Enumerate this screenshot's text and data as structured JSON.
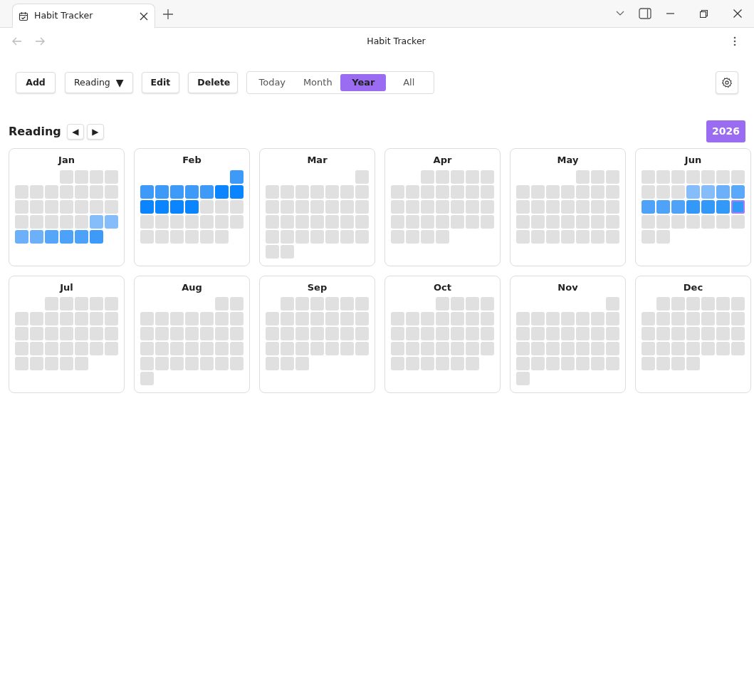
{
  "browser_tab": {
    "title": "Habit Tracker"
  },
  "page_title": "Habit Tracker",
  "toolbar": {
    "add": "Add",
    "habit_select": {
      "label": "Reading",
      "caret": "▼"
    },
    "edit": "Edit",
    "delete": "Delete"
  },
  "range_tabs": [
    {
      "label": "Today",
      "selected": false
    },
    {
      "label": "Month",
      "selected": false
    },
    {
      "label": "Year",
      "selected": true
    },
    {
      "label": "All",
      "selected": false
    }
  ],
  "habit_header": {
    "title": "Reading",
    "prev": "◀",
    "next": "▶",
    "year": "2026"
  },
  "months": [
    {
      "name": "Jan",
      "weeks": [
        [
          {
            "color": "#e0e0e0"
          },
          {
            "color": "#e0e0e0"
          },
          {
            "color": "#e0e0e0"
          },
          {
            "color": "#e0e0e0"
          }
        ],
        [
          {
            "color": "#e0e0e0"
          },
          {
            "color": "#e0e0e0"
          },
          {
            "color": "#e0e0e0"
          },
          {
            "color": "#e0e0e0"
          },
          {
            "color": "#e0e0e0"
          },
          {
            "color": "#e0e0e0"
          },
          {
            "color": "#e0e0e0"
          }
        ],
        [
          {
            "color": "#e0e0e0"
          },
          {
            "color": "#e0e0e0"
          },
          {
            "color": "#e0e0e0"
          },
          {
            "color": "#e0e0e0"
          },
          {
            "color": "#e0e0e0"
          },
          {
            "color": "#e0e0e0"
          },
          {
            "color": "#e0e0e0"
          }
        ],
        [
          {
            "color": "#e0e0e0"
          },
          {
            "color": "#e0e0e0"
          },
          {
            "color": "#e0e0e0"
          },
          {
            "color": "#e0e0e0"
          },
          {
            "color": "#e0e0e0"
          },
          {
            "color": "#85bdfb"
          },
          {
            "color": "#85bdfb"
          }
        ],
        [
          {
            "color": "#6cb0fa"
          },
          {
            "color": "#6cb0fa"
          },
          {
            "color": "#55a5f9"
          },
          {
            "color": "#4ca1f9"
          },
          {
            "color": "#4ca1f9"
          },
          {
            "color": "#3e9af8"
          }
        ]
      ]
    },
    {
      "name": "Feb",
      "weeks": [
        [
          {
            "color": "#3e9af8"
          }
        ],
        [
          {
            "color": "#3e9af8"
          },
          {
            "color": "#3e9af8"
          },
          {
            "color": "#3e9af8"
          },
          {
            "color": "#3e9af8"
          },
          {
            "color": "#3e9af8"
          },
          {
            "color": "#0a84ff"
          },
          {
            "color": "#0a84ff"
          }
        ],
        [
          {
            "color": "#0a84ff"
          },
          {
            "color": "#0a84ff"
          },
          {
            "color": "#0a84ff"
          },
          {
            "color": "#0a84ff"
          },
          {
            "color": "#e0e0e0"
          },
          {
            "color": "#e0e0e0"
          },
          {
            "color": "#e0e0e0"
          }
        ],
        [
          {
            "color": "#e0e0e0"
          },
          {
            "color": "#e0e0e0"
          },
          {
            "color": "#e0e0e0"
          },
          {
            "color": "#e0e0e0"
          },
          {
            "color": "#e0e0e0"
          },
          {
            "color": "#e0e0e0"
          },
          {
            "color": "#e0e0e0"
          }
        ],
        [
          {
            "color": "#e0e0e0"
          },
          {
            "color": "#e0e0e0"
          },
          {
            "color": "#e0e0e0"
          },
          {
            "color": "#e0e0e0"
          },
          {
            "color": "#e0e0e0"
          },
          {
            "color": "#e0e0e0"
          }
        ]
      ]
    },
    {
      "name": "Mar",
      "weeks": [
        [
          {
            "color": "#e0e0e0"
          }
        ],
        [
          {
            "color": "#e0e0e0"
          },
          {
            "color": "#e0e0e0"
          },
          {
            "color": "#e0e0e0"
          },
          {
            "color": "#e0e0e0"
          },
          {
            "color": "#e0e0e0"
          },
          {
            "color": "#e0e0e0"
          },
          {
            "color": "#e0e0e0"
          }
        ],
        [
          {
            "color": "#e0e0e0"
          },
          {
            "color": "#e0e0e0"
          },
          {
            "color": "#e0e0e0"
          },
          {
            "color": "#e0e0e0"
          },
          {
            "color": "#e0e0e0"
          },
          {
            "color": "#e0e0e0"
          },
          {
            "color": "#e0e0e0"
          }
        ],
        [
          {
            "color": "#e0e0e0"
          },
          {
            "color": "#e0e0e0"
          },
          {
            "color": "#e0e0e0"
          },
          {
            "color": "#e0e0e0"
          },
          {
            "color": "#e0e0e0"
          },
          {
            "color": "#e0e0e0"
          },
          {
            "color": "#e0e0e0"
          }
        ],
        [
          {
            "color": "#e0e0e0"
          },
          {
            "color": "#e0e0e0"
          },
          {
            "color": "#e0e0e0"
          },
          {
            "color": "#e0e0e0"
          },
          {
            "color": "#e0e0e0"
          },
          {
            "color": "#e0e0e0"
          },
          {
            "color": "#e0e0e0"
          }
        ],
        [
          {
            "color": "#e0e0e0"
          },
          {
            "color": "#e0e0e0"
          }
        ]
      ]
    },
    {
      "name": "Apr",
      "weeks": [
        [
          {
            "color": "#e0e0e0"
          },
          {
            "color": "#e0e0e0"
          },
          {
            "color": "#e0e0e0"
          },
          {
            "color": "#e0e0e0"
          },
          {
            "color": "#e0e0e0"
          }
        ],
        [
          {
            "color": "#e0e0e0"
          },
          {
            "color": "#e0e0e0"
          },
          {
            "color": "#e0e0e0"
          },
          {
            "color": "#e0e0e0"
          },
          {
            "color": "#e0e0e0"
          },
          {
            "color": "#e0e0e0"
          },
          {
            "color": "#e0e0e0"
          }
        ],
        [
          {
            "color": "#e0e0e0"
          },
          {
            "color": "#e0e0e0"
          },
          {
            "color": "#e0e0e0"
          },
          {
            "color": "#e0e0e0"
          },
          {
            "color": "#e0e0e0"
          },
          {
            "color": "#e0e0e0"
          },
          {
            "color": "#e0e0e0"
          }
        ],
        [
          {
            "color": "#e0e0e0"
          },
          {
            "color": "#e0e0e0"
          },
          {
            "color": "#e0e0e0"
          },
          {
            "color": "#e0e0e0"
          },
          {
            "color": "#e0e0e0"
          },
          {
            "color": "#e0e0e0"
          },
          {
            "color": "#e0e0e0"
          }
        ],
        [
          {
            "color": "#e0e0e0"
          },
          {
            "color": "#e0e0e0"
          },
          {
            "color": "#e0e0e0"
          },
          {
            "color": "#e0e0e0"
          }
        ]
      ]
    },
    {
      "name": "May",
      "weeks": [
        [
          {
            "color": "#e0e0e0"
          },
          {
            "color": "#e0e0e0"
          },
          {
            "color": "#e0e0e0"
          }
        ],
        [
          {
            "color": "#e0e0e0"
          },
          {
            "color": "#e0e0e0"
          },
          {
            "color": "#e0e0e0"
          },
          {
            "color": "#e0e0e0"
          },
          {
            "color": "#e0e0e0"
          },
          {
            "color": "#e0e0e0"
          },
          {
            "color": "#e0e0e0"
          }
        ],
        [
          {
            "color": "#e0e0e0"
          },
          {
            "color": "#e0e0e0"
          },
          {
            "color": "#e0e0e0"
          },
          {
            "color": "#e0e0e0"
          },
          {
            "color": "#e0e0e0"
          },
          {
            "color": "#e0e0e0"
          },
          {
            "color": "#e0e0e0"
          }
        ],
        [
          {
            "color": "#e0e0e0"
          },
          {
            "color": "#e0e0e0"
          },
          {
            "color": "#e0e0e0"
          },
          {
            "color": "#e0e0e0"
          },
          {
            "color": "#e0e0e0"
          },
          {
            "color": "#e0e0e0"
          },
          {
            "color": "#e0e0e0"
          }
        ],
        [
          {
            "color": "#e0e0e0"
          },
          {
            "color": "#e0e0e0"
          },
          {
            "color": "#e0e0e0"
          },
          {
            "color": "#e0e0e0"
          },
          {
            "color": "#e0e0e0"
          },
          {
            "color": "#e0e0e0"
          },
          {
            "color": "#e0e0e0"
          }
        ]
      ]
    },
    {
      "name": "Jun",
      "weeks": [
        [
          {
            "color": "#e0e0e0"
          },
          {
            "color": "#e0e0e0"
          },
          {
            "color": "#e0e0e0"
          },
          {
            "color": "#e0e0e0"
          },
          {
            "color": "#e0e0e0"
          },
          {
            "color": "#e0e0e0"
          },
          {
            "color": "#e0e0e0"
          }
        ],
        [
          {
            "color": "#e0e0e0"
          },
          {
            "color": "#e0e0e0"
          },
          {
            "color": "#e0e0e0"
          },
          {
            "color": "#85bdfb"
          },
          {
            "color": "#85bdfb"
          },
          {
            "color": "#6cb0fa"
          },
          {
            "color": "#5aa8fa"
          }
        ],
        [
          {
            "color": "#4ea3f9"
          },
          {
            "color": "#4ea3f9"
          },
          {
            "color": "#4ea3f9"
          },
          {
            "color": "#3399f8"
          },
          {
            "color": "#3399f8"
          },
          {
            "color": "#3399f8"
          },
          {
            "color": "#3399f8",
            "today": true
          }
        ],
        [
          {
            "color": "#e0e0e0"
          },
          {
            "color": "#e0e0e0"
          },
          {
            "color": "#e0e0e0"
          },
          {
            "color": "#e0e0e0"
          },
          {
            "color": "#e0e0e0"
          },
          {
            "color": "#e0e0e0"
          },
          {
            "color": "#e0e0e0"
          }
        ],
        [
          {
            "color": "#e0e0e0"
          },
          {
            "color": "#e0e0e0"
          }
        ]
      ]
    },
    {
      "name": "Jul",
      "weeks": [
        [
          {
            "color": "#e0e0e0"
          },
          {
            "color": "#e0e0e0"
          },
          {
            "color": "#e0e0e0"
          },
          {
            "color": "#e0e0e0"
          },
          {
            "color": "#e0e0e0"
          }
        ],
        [
          {
            "color": "#e0e0e0"
          },
          {
            "color": "#e0e0e0"
          },
          {
            "color": "#e0e0e0"
          },
          {
            "color": "#e0e0e0"
          },
          {
            "color": "#e0e0e0"
          },
          {
            "color": "#e0e0e0"
          },
          {
            "color": "#e0e0e0"
          }
        ],
        [
          {
            "color": "#e0e0e0"
          },
          {
            "color": "#e0e0e0"
          },
          {
            "color": "#e0e0e0"
          },
          {
            "color": "#e0e0e0"
          },
          {
            "color": "#e0e0e0"
          },
          {
            "color": "#e0e0e0"
          },
          {
            "color": "#e0e0e0"
          }
        ],
        [
          {
            "color": "#e0e0e0"
          },
          {
            "color": "#e0e0e0"
          },
          {
            "color": "#e0e0e0"
          },
          {
            "color": "#e0e0e0"
          },
          {
            "color": "#e0e0e0"
          },
          {
            "color": "#e0e0e0"
          },
          {
            "color": "#e0e0e0"
          }
        ],
        [
          {
            "color": "#e0e0e0"
          },
          {
            "color": "#e0e0e0"
          },
          {
            "color": "#e0e0e0"
          },
          {
            "color": "#e0e0e0"
          },
          {
            "color": "#e0e0e0"
          }
        ]
      ]
    },
    {
      "name": "Aug",
      "weeks": [
        [
          {
            "color": "#e0e0e0"
          },
          {
            "color": "#e0e0e0"
          }
        ],
        [
          {
            "color": "#e0e0e0"
          },
          {
            "color": "#e0e0e0"
          },
          {
            "color": "#e0e0e0"
          },
          {
            "color": "#e0e0e0"
          },
          {
            "color": "#e0e0e0"
          },
          {
            "color": "#e0e0e0"
          },
          {
            "color": "#e0e0e0"
          }
        ],
        [
          {
            "color": "#e0e0e0"
          },
          {
            "color": "#e0e0e0"
          },
          {
            "color": "#e0e0e0"
          },
          {
            "color": "#e0e0e0"
          },
          {
            "color": "#e0e0e0"
          },
          {
            "color": "#e0e0e0"
          },
          {
            "color": "#e0e0e0"
          }
        ],
        [
          {
            "color": "#e0e0e0"
          },
          {
            "color": "#e0e0e0"
          },
          {
            "color": "#e0e0e0"
          },
          {
            "color": "#e0e0e0"
          },
          {
            "color": "#e0e0e0"
          },
          {
            "color": "#e0e0e0"
          },
          {
            "color": "#e0e0e0"
          }
        ],
        [
          {
            "color": "#e0e0e0"
          },
          {
            "color": "#e0e0e0"
          },
          {
            "color": "#e0e0e0"
          },
          {
            "color": "#e0e0e0"
          },
          {
            "color": "#e0e0e0"
          },
          {
            "color": "#e0e0e0"
          },
          {
            "color": "#e0e0e0"
          }
        ],
        [
          {
            "color": "#e0e0e0"
          }
        ]
      ]
    },
    {
      "name": "Sep",
      "weeks": [
        [
          {
            "color": "#e0e0e0"
          },
          {
            "color": "#e0e0e0"
          },
          {
            "color": "#e0e0e0"
          },
          {
            "color": "#e0e0e0"
          },
          {
            "color": "#e0e0e0"
          },
          {
            "color": "#e0e0e0"
          }
        ],
        [
          {
            "color": "#e0e0e0"
          },
          {
            "color": "#e0e0e0"
          },
          {
            "color": "#e0e0e0"
          },
          {
            "color": "#e0e0e0"
          },
          {
            "color": "#e0e0e0"
          },
          {
            "color": "#e0e0e0"
          },
          {
            "color": "#e0e0e0"
          }
        ],
        [
          {
            "color": "#e0e0e0"
          },
          {
            "color": "#e0e0e0"
          },
          {
            "color": "#e0e0e0"
          },
          {
            "color": "#e0e0e0"
          },
          {
            "color": "#e0e0e0"
          },
          {
            "color": "#e0e0e0"
          },
          {
            "color": "#e0e0e0"
          }
        ],
        [
          {
            "color": "#e0e0e0"
          },
          {
            "color": "#e0e0e0"
          },
          {
            "color": "#e0e0e0"
          },
          {
            "color": "#e0e0e0"
          },
          {
            "color": "#e0e0e0"
          },
          {
            "color": "#e0e0e0"
          },
          {
            "color": "#e0e0e0"
          }
        ],
        [
          {
            "color": "#e0e0e0"
          },
          {
            "color": "#e0e0e0"
          },
          {
            "color": "#e0e0e0"
          }
        ]
      ]
    },
    {
      "name": "Oct",
      "weeks": [
        [
          {
            "color": "#e0e0e0"
          },
          {
            "color": "#e0e0e0"
          },
          {
            "color": "#e0e0e0"
          },
          {
            "color": "#e0e0e0"
          }
        ],
        [
          {
            "color": "#e0e0e0"
          },
          {
            "color": "#e0e0e0"
          },
          {
            "color": "#e0e0e0"
          },
          {
            "color": "#e0e0e0"
          },
          {
            "color": "#e0e0e0"
          },
          {
            "color": "#e0e0e0"
          },
          {
            "color": "#e0e0e0"
          }
        ],
        [
          {
            "color": "#e0e0e0"
          },
          {
            "color": "#e0e0e0"
          },
          {
            "color": "#e0e0e0"
          },
          {
            "color": "#e0e0e0"
          },
          {
            "color": "#e0e0e0"
          },
          {
            "color": "#e0e0e0"
          },
          {
            "color": "#e0e0e0"
          }
        ],
        [
          {
            "color": "#e0e0e0"
          },
          {
            "color": "#e0e0e0"
          },
          {
            "color": "#e0e0e0"
          },
          {
            "color": "#e0e0e0"
          },
          {
            "color": "#e0e0e0"
          },
          {
            "color": "#e0e0e0"
          },
          {
            "color": "#e0e0e0"
          }
        ],
        [
          {
            "color": "#e0e0e0"
          },
          {
            "color": "#e0e0e0"
          },
          {
            "color": "#e0e0e0"
          },
          {
            "color": "#e0e0e0"
          },
          {
            "color": "#e0e0e0"
          },
          {
            "color": "#e0e0e0"
          }
        ]
      ]
    },
    {
      "name": "Nov",
      "weeks": [
        [
          {
            "color": "#e0e0e0"
          }
        ],
        [
          {
            "color": "#e0e0e0"
          },
          {
            "color": "#e0e0e0"
          },
          {
            "color": "#e0e0e0"
          },
          {
            "color": "#e0e0e0"
          },
          {
            "color": "#e0e0e0"
          },
          {
            "color": "#e0e0e0"
          },
          {
            "color": "#e0e0e0"
          }
        ],
        [
          {
            "color": "#e0e0e0"
          },
          {
            "color": "#e0e0e0"
          },
          {
            "color": "#e0e0e0"
          },
          {
            "color": "#e0e0e0"
          },
          {
            "color": "#e0e0e0"
          },
          {
            "color": "#e0e0e0"
          },
          {
            "color": "#e0e0e0"
          }
        ],
        [
          {
            "color": "#e0e0e0"
          },
          {
            "color": "#e0e0e0"
          },
          {
            "color": "#e0e0e0"
          },
          {
            "color": "#e0e0e0"
          },
          {
            "color": "#e0e0e0"
          },
          {
            "color": "#e0e0e0"
          },
          {
            "color": "#e0e0e0"
          }
        ],
        [
          {
            "color": "#e0e0e0"
          },
          {
            "color": "#e0e0e0"
          },
          {
            "color": "#e0e0e0"
          },
          {
            "color": "#e0e0e0"
          },
          {
            "color": "#e0e0e0"
          },
          {
            "color": "#e0e0e0"
          },
          {
            "color": "#e0e0e0"
          }
        ],
        [
          {
            "color": "#e0e0e0"
          }
        ]
      ]
    },
    {
      "name": "Dec",
      "weeks": [
        [
          {
            "color": "#e0e0e0"
          },
          {
            "color": "#e0e0e0"
          },
          {
            "color": "#e0e0e0"
          },
          {
            "color": "#e0e0e0"
          },
          {
            "color": "#e0e0e0"
          },
          {
            "color": "#e0e0e0"
          }
        ],
        [
          {
            "color": "#e0e0e0"
          },
          {
            "color": "#e0e0e0"
          },
          {
            "color": "#e0e0e0"
          },
          {
            "color": "#e0e0e0"
          },
          {
            "color": "#e0e0e0"
          },
          {
            "color": "#e0e0e0"
          },
          {
            "color": "#e0e0e0"
          }
        ],
        [
          {
            "color": "#e0e0e0"
          },
          {
            "color": "#e0e0e0"
          },
          {
            "color": "#e0e0e0"
          },
          {
            "color": "#e0e0e0"
          },
          {
            "color": "#e0e0e0"
          },
          {
            "color": "#e0e0e0"
          },
          {
            "color": "#e0e0e0"
          }
        ],
        [
          {
            "color": "#e0e0e0"
          },
          {
            "color": "#e0e0e0"
          },
          {
            "color": "#e0e0e0"
          },
          {
            "color": "#e0e0e0"
          },
          {
            "color": "#e0e0e0"
          },
          {
            "color": "#e0e0e0"
          },
          {
            "color": "#e0e0e0"
          }
        ],
        [
          {
            "color": "#e0e0e0"
          },
          {
            "color": "#e0e0e0"
          },
          {
            "color": "#e0e0e0"
          },
          {
            "color": "#e0e0e0"
          }
        ]
      ]
    }
  ]
}
